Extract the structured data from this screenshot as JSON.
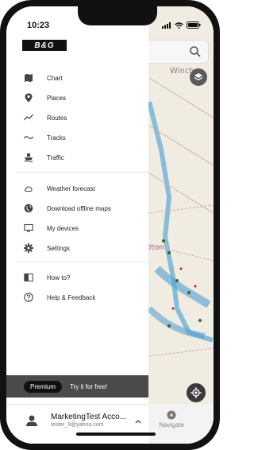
{
  "status": {
    "time": "10:23"
  },
  "brand": {
    "logo_text": "B&G"
  },
  "menu": {
    "group1": [
      {
        "label": "Chart",
        "icon": "map-icon"
      },
      {
        "label": "Places",
        "icon": "pin-icon"
      },
      {
        "label": "Routes",
        "icon": "routes-icon"
      },
      {
        "label": "Tracks",
        "icon": "tracks-icon"
      },
      {
        "label": "Traffic",
        "icon": "ship-icon"
      }
    ],
    "group2": [
      {
        "label": "Weather forecast",
        "icon": "cloud-icon"
      },
      {
        "label": "Download offline maps",
        "icon": "globe-icon"
      },
      {
        "label": "My devices",
        "icon": "monitor-icon"
      },
      {
        "label": "Settings",
        "icon": "gear-icon"
      }
    ],
    "group3": [
      {
        "label": "How to?",
        "icon": "book-icon"
      },
      {
        "label": "Help & Feedback",
        "icon": "help-icon"
      }
    ]
  },
  "premium": {
    "badge": "Premium",
    "cta": "Try it for free!"
  },
  "account": {
    "name": "MarketingTest Acco...",
    "email": "tester_9@yahoo.com"
  },
  "map": {
    "label1": "Winches",
    "label2": "pton",
    "nav_label": "Navigate"
  },
  "colors": {
    "drawer_bg": "#ffffff",
    "premium_bar": "#4a4a4a",
    "text": "#222222"
  }
}
